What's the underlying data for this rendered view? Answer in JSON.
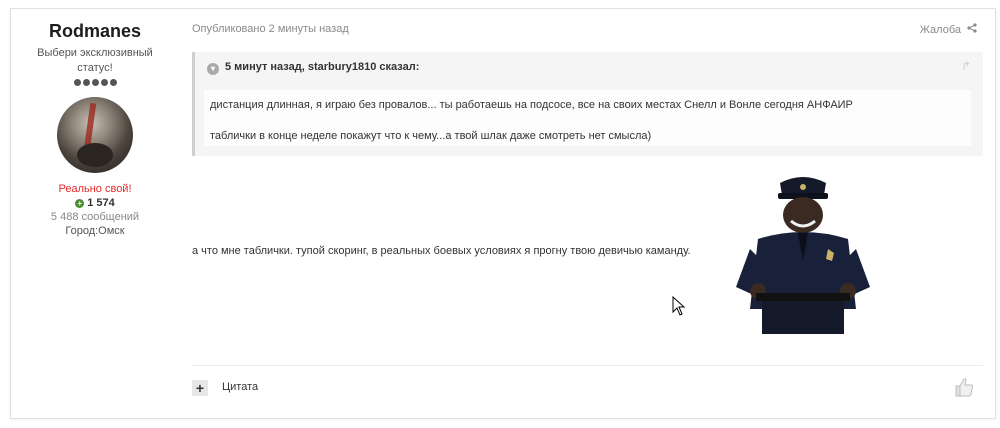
{
  "author": {
    "username": "Rodmanes",
    "status_text": "Выбери эксклюзивный статус!",
    "rank_dots": 5,
    "member_title": "Реально свой!",
    "reputation": "1 574",
    "post_count": "5 488 сообщений",
    "location": "Город:Омск"
  },
  "post": {
    "meta": "Опубликовано 2 минуты назад",
    "report_label": "Жалоба",
    "quote": {
      "header": "5 минут назад, starbury1810 сказал:",
      "line1": "дистанция длинная, я играю без провалов... ты работаешь на подсосе, все на своих местах Снелл и Вонле сегодня АНФАИР",
      "line2": "таблички в конце неделе покажут что к чему...а твой шлак даже смотреть нет смысла)"
    },
    "reply_text": "а что мне таблички. тупой скоринг, в реальных боевых условиях я прогну твою девичью каманду.",
    "quote_button_label": "Цитата"
  },
  "colors": {
    "member_title": "#e62a2a",
    "reputation_icon": "#4b8b32",
    "quote_background": "#f5f5f5"
  },
  "icons": {
    "rep": "plus-circle-icon",
    "share": "share-icon",
    "collapse": "chevron-down-icon",
    "quote_link": "reply-arrow-icon",
    "like": "thumbs-up-icon"
  }
}
